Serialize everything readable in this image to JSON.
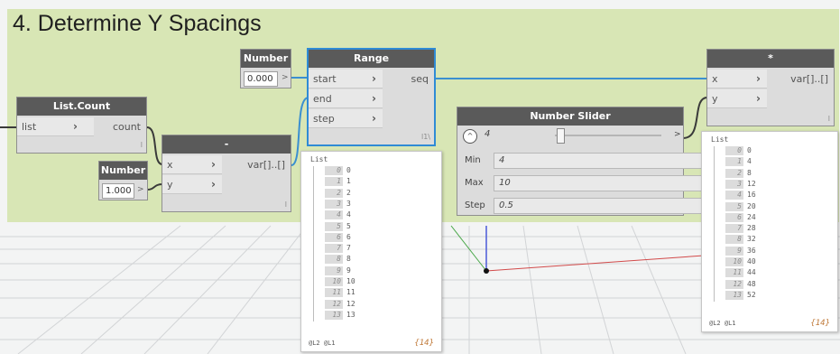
{
  "group_title": "4. Determine Y Spacings",
  "nodes": {
    "number_top": {
      "title": "Number",
      "value": "0.000",
      "arrow": ">"
    },
    "number_bottom": {
      "title": "Number",
      "value": "1.000",
      "arrow": ">"
    },
    "list_count": {
      "title": "List.Count",
      "in_port": "list",
      "out_port": "count",
      "lacing": "l"
    },
    "subtract": {
      "title": "-",
      "in_ports": [
        "x",
        "y"
      ],
      "out_port": "var[]..[]",
      "lacing": "l"
    },
    "range": {
      "title": "Range",
      "in_ports": [
        "start",
        "end",
        "step"
      ],
      "out_port": "seq",
      "lacing": "l1\\"
    },
    "multiply": {
      "title": "*",
      "in_ports": [
        "x",
        "y"
      ],
      "out_port": "var[]..[]",
      "lacing": "l"
    },
    "slider": {
      "title": "Number Slider",
      "value": "4",
      "slider_position": 0.017,
      "min_label": "Min",
      "min": "4",
      "max_label": "Max",
      "max": "10",
      "step_label": "Step",
      "step": "0.5",
      "expand_arrow": ">"
    }
  },
  "previews": {
    "range": {
      "header": "List",
      "items": [
        [
          "0",
          "0"
        ],
        [
          "1",
          "1"
        ],
        [
          "2",
          "2"
        ],
        [
          "3",
          "3"
        ],
        [
          "4",
          "4"
        ],
        [
          "5",
          "5"
        ],
        [
          "6",
          "6"
        ],
        [
          "7",
          "7"
        ],
        [
          "8",
          "8"
        ],
        [
          "9",
          "9"
        ],
        [
          "10",
          "10"
        ],
        [
          "11",
          "11"
        ],
        [
          "12",
          "12"
        ],
        [
          "13",
          "13"
        ]
      ],
      "footer": "@L2 @L1",
      "count": "{14}"
    },
    "multiply": {
      "header": "List",
      "items": [
        [
          "0",
          "0"
        ],
        [
          "1",
          "4"
        ],
        [
          "2",
          "8"
        ],
        [
          "3",
          "12"
        ],
        [
          "4",
          "16"
        ],
        [
          "5",
          "20"
        ],
        [
          "6",
          "24"
        ],
        [
          "7",
          "28"
        ],
        [
          "8",
          "32"
        ],
        [
          "9",
          "36"
        ],
        [
          "10",
          "40"
        ],
        [
          "11",
          "44"
        ],
        [
          "12",
          "48"
        ],
        [
          "13",
          "52"
        ]
      ],
      "footer": "@L2 @L1",
      "count": "{14}"
    }
  },
  "colors": {
    "wire": "#3a8fd0",
    "header": "#5a5a5a",
    "selected": "#2f8bd5",
    "group": "#d8e6b5",
    "axis_x": "#d24a4a",
    "axis_y": "#4a5ad8"
  }
}
